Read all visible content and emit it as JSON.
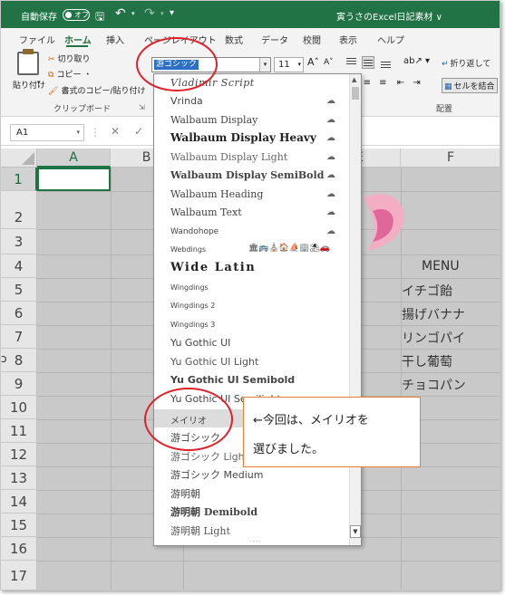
{
  "titlebar": {
    "autosave_label": "自動保存",
    "toggle_label": "オフ",
    "document_title": "寅うさのExcel日記素材 ∨"
  },
  "tabs": [
    "ファイル",
    "ホーム",
    "挿入",
    "ページレイアウト",
    "数式",
    "データ",
    "校閲",
    "表示",
    "ヘルプ"
  ],
  "active_tab": "ホーム",
  "ribbon": {
    "paste_label": "貼り付け",
    "cut_label": "切り取り",
    "copy_label": "コピー ・",
    "format_painter_label": "書式のコピー/貼り付け",
    "clipboard_group": "クリップボード",
    "font_name": "游ゴシック",
    "font_size": "11",
    "grow_font": "A˄",
    "shrink_font": "A˅",
    "wrap_text_label": "折り返して",
    "merge_label": "セルを結合",
    "alignment_group": "配置"
  },
  "formula_bar": {
    "name_box": "A1",
    "cancel": "✕",
    "enter": "✓"
  },
  "columns": [
    "A",
    "B",
    "E",
    "F"
  ],
  "rows": [
    "1",
    "2",
    "3",
    "4",
    "5",
    "6",
    "7",
    "8",
    "9",
    "10",
    "11",
    "12",
    "13",
    "14",
    "15",
    "16",
    "17"
  ],
  "sheet": {
    "menu_title": "MENU",
    "menu_items": [
      "イチゴ飴",
      "揚げバナナ",
      "リンゴパイ",
      "干し葡萄",
      "チョコパン"
    ]
  },
  "font_list": [
    {
      "name": "Vladimir Script",
      "cloud": false
    },
    {
      "name": "Vrinda",
      "cloud": true
    },
    {
      "name": "Walbaum Display",
      "cloud": true
    },
    {
      "name": "Walbaum Display Heavy",
      "cloud": true
    },
    {
      "name": "Walbaum Display Light",
      "cloud": true
    },
    {
      "name": "Walbaum Display SemiBold",
      "cloud": true
    },
    {
      "name": "Walbaum Heading",
      "cloud": true
    },
    {
      "name": "Walbaum Text",
      "cloud": true
    },
    {
      "name": "Wandohope",
      "cloud": true
    },
    {
      "name": "Webdings",
      "cloud": false
    },
    {
      "name": "Wide Latin",
      "cloud": false
    },
    {
      "name": "Wingdings",
      "cloud": false
    },
    {
      "name": "Wingdings 2",
      "cloud": false
    },
    {
      "name": "Wingdings 3",
      "cloud": false
    },
    {
      "name": "Yu Gothic UI",
      "cloud": false
    },
    {
      "name": "Yu Gothic UI Light",
      "cloud": false
    },
    {
      "name": "Yu Gothic UI Semibold",
      "cloud": false
    },
    {
      "name": "Yu Gothic UI Semilight",
      "cloud": false
    },
    {
      "name": "メイリオ",
      "cloud": false
    },
    {
      "name": "游ゴシック",
      "cloud": false
    },
    {
      "name": "游ゴシック Light",
      "cloud": false
    },
    {
      "name": "游ゴシック Medium",
      "cloud": false
    },
    {
      "name": "游明朝",
      "cloud": false
    },
    {
      "name": "游明朝 Demibold",
      "cloud": false
    },
    {
      "name": "游明朝 Light",
      "cloud": false
    }
  ],
  "webdings_sample": "🏛🚌⛪🏠⛵🏢⛱🚗",
  "highlighted_font": "メイリオ",
  "callout": {
    "line1": "←今回は、メイリオを",
    "line2": "選びました。"
  },
  "colors": {
    "accent": "#217346",
    "annotation_circle": "#e0202a",
    "callout_border": "#ed7d31",
    "heart_outer": "#f4aec4",
    "heart_inner": "#e0679a"
  }
}
